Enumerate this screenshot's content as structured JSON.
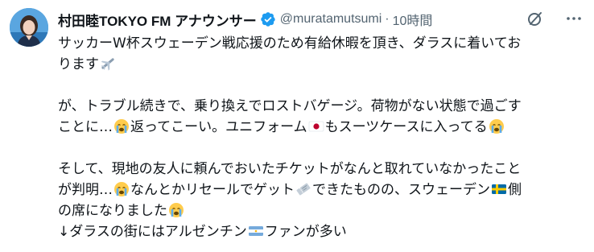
{
  "tweet": {
    "display_name": "村田睦TOKYO FM アナウンサー",
    "handle": "@muratamutsumi",
    "separator": "·",
    "timestamp": "10時間",
    "verified_color": "#1d9bf0",
    "text_color": "#0f1419",
    "secondary_color": "#536471",
    "paragraphs": [
      {
        "lines": [
          {
            "segments": [
              {
                "text": "サッカーW杯スウェーデン戦応援のため有給休暇を頂き、ダラスに着いてお"
              }
            ]
          },
          {
            "segments": [
              {
                "text": "ります"
              },
              {
                "emoji": "airplane-emoji"
              }
            ]
          }
        ]
      },
      {
        "lines": [
          {
            "segments": [
              {
                "text": "が、トラブル続きで、乗り換えでロストバゲージ。荷物がない状態で過ごす"
              }
            ]
          },
          {
            "segments": [
              {
                "text": "ことに…"
              },
              {
                "emoji": "crying-face-emoji"
              },
              {
                "text": "返ってこーい。ユニフォーム"
              },
              {
                "emoji": "japan-flag-emoji"
              },
              {
                "text": "もスーツケースに入ってる"
              },
              {
                "emoji": "crying-face-emoji"
              }
            ]
          }
        ]
      },
      {
        "lines": [
          {
            "segments": [
              {
                "text": "そして、現地の友人に頼んでおいたチケットがなんと取れていなかったこと"
              }
            ]
          },
          {
            "segments": [
              {
                "text": "が判明…"
              },
              {
                "emoji": "crying-face-emoji"
              },
              {
                "text": "なんとかリセールでゲット"
              },
              {
                "emoji": "ticket-emoji"
              },
              {
                "text": "できたものの、スウェーデン"
              },
              {
                "emoji": "sweden-flag-emoji"
              },
              {
                "text": "側"
              }
            ]
          },
          {
            "segments": [
              {
                "text": "の席になりました"
              },
              {
                "emoji": "crying-face-emoji"
              }
            ]
          },
          {
            "segments": [
              {
                "text": "↓ダラスの街にはアルゼンチン"
              },
              {
                "emoji": "argentina-flag-emoji"
              },
              {
                "text": "ファンが多い"
              }
            ]
          }
        ]
      }
    ]
  },
  "actions": {
    "grok_icon": "grok-icon",
    "more_icon": "more-options-icon"
  }
}
